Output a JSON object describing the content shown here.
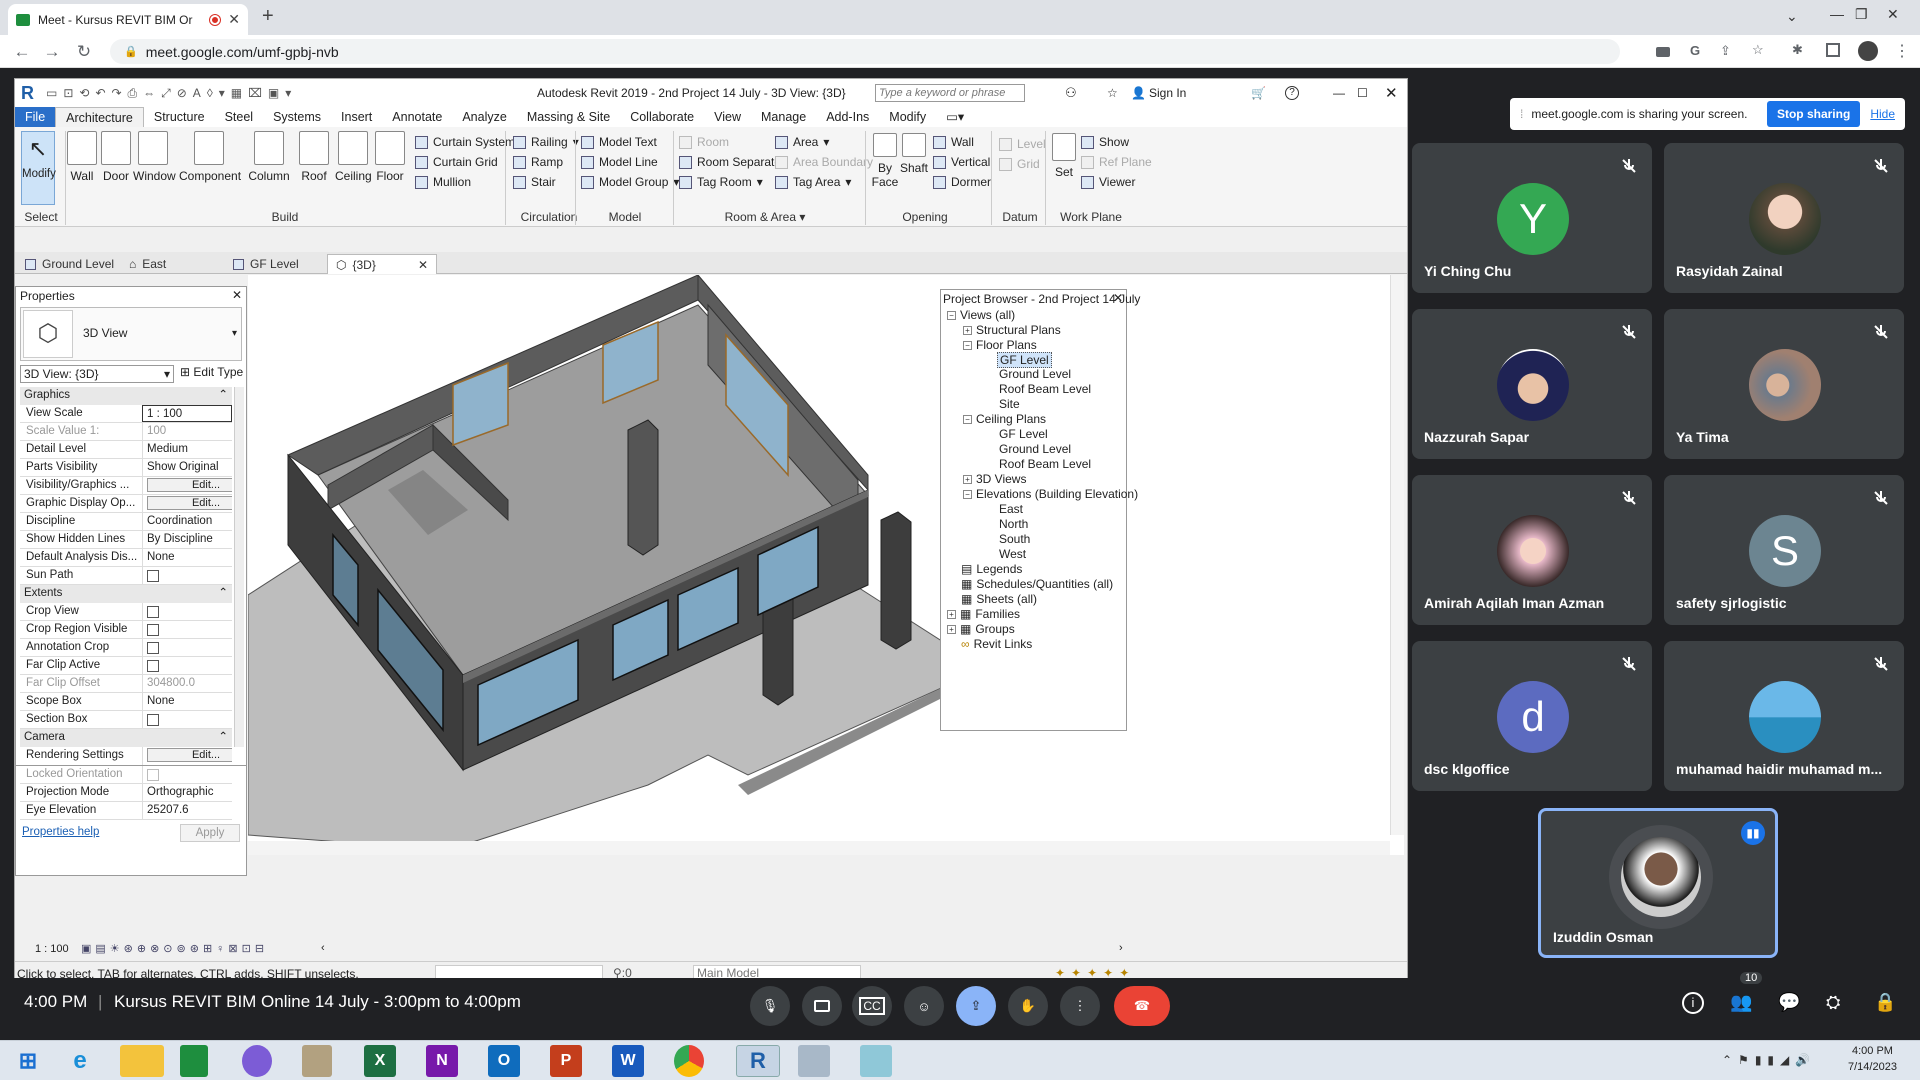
{
  "browser": {
    "tab_title": "Meet - Kursus REVIT BIM Or",
    "url": "meet.google.com/umf-gpbj-nvb"
  },
  "revit": {
    "title": "Autodesk Revit 2019 - 2nd Project 14 July - 3D View: {3D}",
    "search_placeholder": "Type a keyword or phrase",
    "sign_in": "Sign In",
    "menu": [
      "File",
      "Architecture",
      "Structure",
      "Steel",
      "Systems",
      "Insert",
      "Annotate",
      "Analyze",
      "Massing & Site",
      "Collaborate",
      "View",
      "Manage",
      "Add-Ins",
      "Modify"
    ],
    "ribbon": {
      "modify": "Modify",
      "select": "Select",
      "wall": "Wall",
      "door": "Door",
      "window": "Window",
      "component": "Component",
      "column": "Column",
      "roof": "Roof",
      "ceiling": "Ceiling",
      "floor": "Floor",
      "curtain_system": "Curtain System",
      "curtain_grid": "Curtain Grid",
      "mullion": "Mullion",
      "build": "Build",
      "railing": "Railing",
      "ramp": "Ramp",
      "stair": "Stair",
      "circulation": "Circulation",
      "model_text": "Model Text",
      "model_line": "Model Line",
      "model_group": "Model Group",
      "model": "Model",
      "room": "Room",
      "room_separator": "Room Separator",
      "tag_room": "Tag Room",
      "area": "Area",
      "area_boundary": "Area Boundary",
      "tag_area": "Tag Area",
      "room_area": "Room & Area",
      "by_face_1": "By",
      "by_face_2": "Face",
      "shaft": "Shaft",
      "wall_open": "Wall",
      "vertical": "Vertical",
      "dormer": "Dormer",
      "opening": "Opening",
      "level": "Level",
      "grid": "Grid",
      "datum": "Datum",
      "set": "Set",
      "show": "Show",
      "ref_plane": "Ref Plane",
      "viewer": "Viewer",
      "work_plane": "Work Plane"
    },
    "view_tabs": [
      "Ground Level",
      "East",
      "GF Level",
      "{3D}"
    ],
    "properties": {
      "header": "Properties",
      "type_name": "3D View",
      "view_select": "3D View: {3D}",
      "edit_type": "Edit Type",
      "sec_graphics": "Graphics",
      "sec_extents": "Extents",
      "sec_camera": "Camera",
      "rows": [
        {
          "k": "View Scale",
          "v": "1 : 100"
        },
        {
          "k": "Scale Value    1:",
          "v": "100"
        },
        {
          "k": "Detail Level",
          "v": "Medium"
        },
        {
          "k": "Parts Visibility",
          "v": "Show Original"
        },
        {
          "k": "Visibility/Graphics ...",
          "v": "Edit..."
        },
        {
          "k": "Graphic Display Op...",
          "v": "Edit..."
        },
        {
          "k": "Discipline",
          "v": "Coordination"
        },
        {
          "k": "Show Hidden Lines",
          "v": "By Discipline"
        },
        {
          "k": "Default Analysis Dis...",
          "v": "None"
        },
        {
          "k": "Sun Path",
          "v": ""
        },
        {
          "k": "Crop View",
          "v": ""
        },
        {
          "k": "Crop Region Visible",
          "v": ""
        },
        {
          "k": "Annotation Crop",
          "v": ""
        },
        {
          "k": "Far Clip Active",
          "v": ""
        },
        {
          "k": "Far Clip Offset",
          "v": "304800.0"
        },
        {
          "k": "Scope Box",
          "v": "None"
        },
        {
          "k": "Section Box",
          "v": ""
        },
        {
          "k": "Rendering Settings",
          "v": "Edit..."
        },
        {
          "k": "Locked Orientation",
          "v": ""
        },
        {
          "k": "Projection Mode",
          "v": "Orthographic"
        },
        {
          "k": "Eye Elevation",
          "v": "25207.6"
        }
      ],
      "help": "Properties help",
      "apply": "Apply"
    },
    "project_browser": {
      "title": "Project Browser - 2nd Project 14 July",
      "items": [
        "Views (all)",
        "Structural Plans",
        "Floor Plans",
        "GF Level",
        "Ground Level",
        "Roof Beam Level",
        "Site",
        "Ceiling Plans",
        "GF Level",
        "Ground Level",
        "Roof Beam Level",
        "3D Views",
        "Elevations (Building Elevation)",
        "East",
        "North",
        "South",
        "West",
        "Legends",
        "Schedules/Quantities (all)",
        "Sheets (all)",
        "Families",
        "Groups",
        "Revit Links"
      ]
    },
    "view_scale": "1 : 100",
    "status_text": "Click to select, TAB for alternates, CTRL adds, SHIFT unselects.",
    "status_zero": ":0",
    "main_model": "Main Model"
  },
  "meet": {
    "share_notice": "meet.google.com is sharing your screen.",
    "stop_sharing": "Stop sharing",
    "hide": "Hide",
    "participants": [
      {
        "name": "Yi Ching Chu",
        "initial": "Y",
        "color": "#34a853"
      },
      {
        "name": "Rasyidah Zainal",
        "initial": "",
        "color": "#7a6a5a"
      },
      {
        "name": "Nazzurah Sapar",
        "initial": "",
        "color": "#2b2f6b"
      },
      {
        "name": "Ya Tima",
        "initial": "",
        "color": "#6b5d58"
      },
      {
        "name": "Amirah Aqilah Iman Azman",
        "initial": "",
        "color": "#c9a7a9"
      },
      {
        "name": "safety sjrlogistic",
        "initial": "S",
        "color": "#6c8591"
      },
      {
        "name": "dsc klgoffice",
        "initial": "d",
        "color": "#5c6bc0"
      },
      {
        "name": "muhamad haidir muhamad m...",
        "initial": "",
        "color": "#3f8fbf"
      },
      {
        "name": "Izuddin Osman",
        "initial": "",
        "color": "#555"
      }
    ],
    "time": "4:00 PM",
    "meeting_title": "Kursus REVIT BIM Online 14 July - 3:00pm to 4:00pm",
    "people_count": "10"
  },
  "taskbar": {
    "time": "4:00 PM",
    "date": "7/14/2023"
  }
}
